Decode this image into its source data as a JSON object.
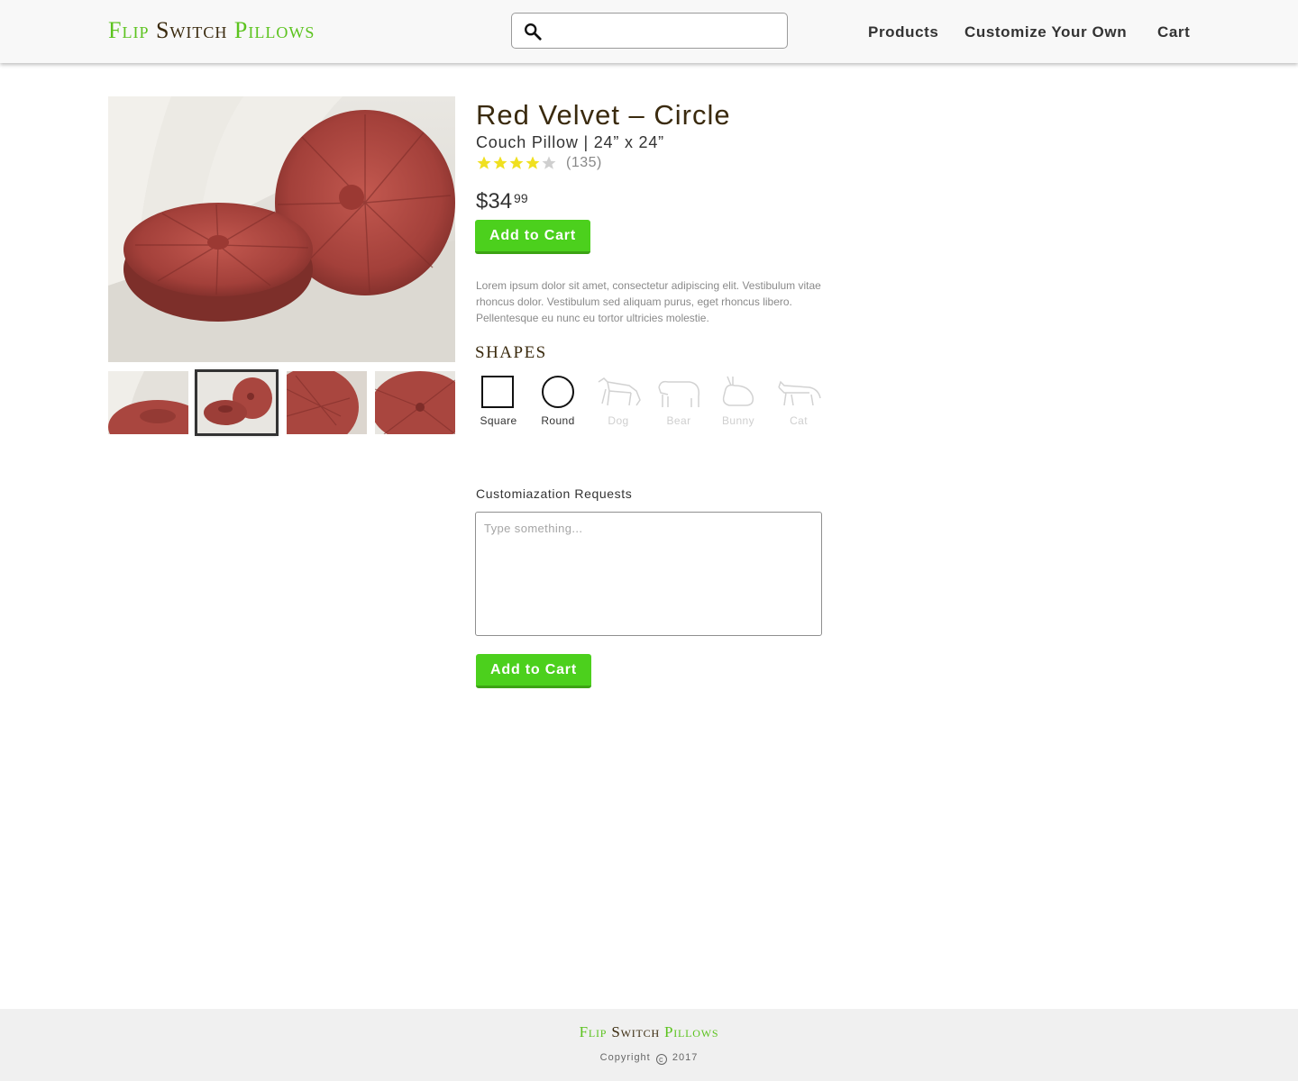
{
  "header": {
    "logo": {
      "word1": "Flip",
      "word2": "Switch",
      "word3": "Pillows"
    },
    "search": {
      "placeholder": "",
      "value": ""
    },
    "nav": {
      "products": "Products",
      "customize": "Customize Your Own",
      "cart": "Cart"
    }
  },
  "gallery": {
    "thumbnail_count": 4,
    "active_thumbnail": 2
  },
  "product": {
    "title": "Red Velvet – Circle",
    "subtitle": "Couch Pillow | 24” x 24”",
    "rating": {
      "stars": 4,
      "max": 5,
      "review_count": "(135)"
    },
    "price": {
      "dollars": "$34",
      "cents": "99"
    },
    "add_to_cart_label": "Add to Cart",
    "description": "Lorem ipsum dolor sit amet, consectetur adipiscing elit. Vestibulum vitae rhoncus dolor. Vestibulum sed aliquam purus, eget rhoncus libero. Pellentesque eu nunc eu tortor ultricies molestie."
  },
  "shapes": {
    "heading": "SHAPES",
    "items": [
      {
        "label": "Square",
        "icon": "square-icon",
        "enabled": true
      },
      {
        "label": "Round",
        "icon": "circle-icon",
        "enabled": true
      },
      {
        "label": "Dog",
        "icon": "dog-icon",
        "enabled": false
      },
      {
        "label": "Bear",
        "icon": "bear-icon",
        "enabled": false
      },
      {
        "label": "Bunny",
        "icon": "bunny-icon",
        "enabled": false
      },
      {
        "label": "Cat",
        "icon": "cat-icon",
        "enabled": false
      }
    ]
  },
  "customization": {
    "label": "Customiazation Requests",
    "placeholder": "Type something...",
    "value": "",
    "add_to_cart_label": "Add to Cart"
  },
  "footer": {
    "logo": {
      "word1": "Flip",
      "word2": "Switch",
      "word3": "Pillows"
    },
    "copyright_prefix": "Copyright",
    "copyright_symbol": "c",
    "copyright_year": "2017"
  },
  "colors": {
    "brand_green": "#5cc31f",
    "brand_brown": "#3a2a0e",
    "button_green": "#4cd01d",
    "star_yellow": "#f0e020",
    "star_gray": "#cfcfcf",
    "pillow_red": "#a9463f"
  }
}
